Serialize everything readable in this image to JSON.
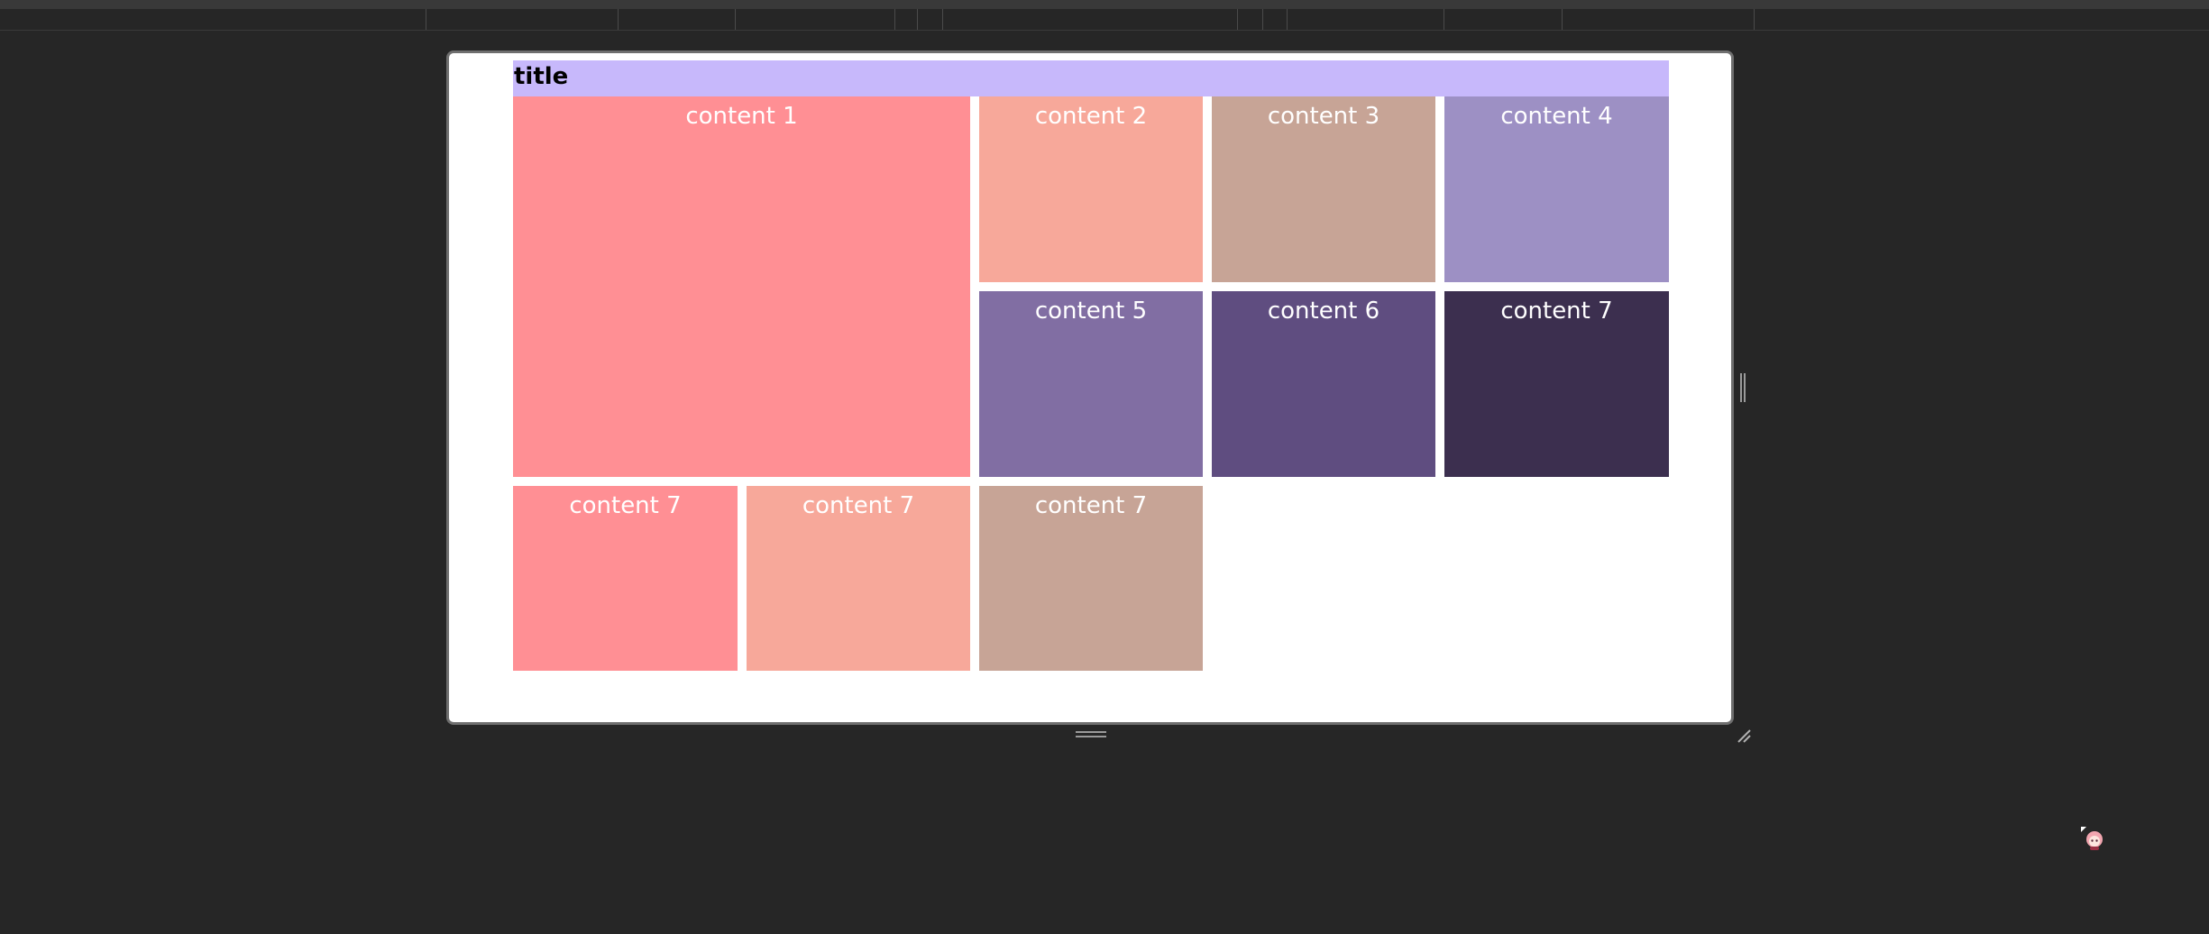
{
  "layout_preview": {
    "title": "title",
    "cells": [
      {
        "label": "content 1",
        "color": "#ff8f94"
      },
      {
        "label": "content 2",
        "color": "#f7a89a"
      },
      {
        "label": "content 3",
        "color": "#c7a496"
      },
      {
        "label": "content 4",
        "color": "#9d90c4"
      },
      {
        "label": "content 5",
        "color": "#816ea3"
      },
      {
        "label": "content 6",
        "color": "#5f4d80"
      },
      {
        "label": "content 7",
        "color": "#3c2f4f"
      },
      {
        "label": "content 7",
        "color": "#ff8f94"
      },
      {
        "label": "content 7",
        "color": "#f7a89a"
      },
      {
        "label": "content 7",
        "color": "#c7a496"
      }
    ],
    "title_color": "#c7b8fb"
  },
  "icons": {
    "right_handle": "vertical-resize-handle-icon",
    "bottom_handle": "horizontal-resize-handle-icon",
    "corner": "resize-corner-icon",
    "mascot": "mascot-icon"
  }
}
